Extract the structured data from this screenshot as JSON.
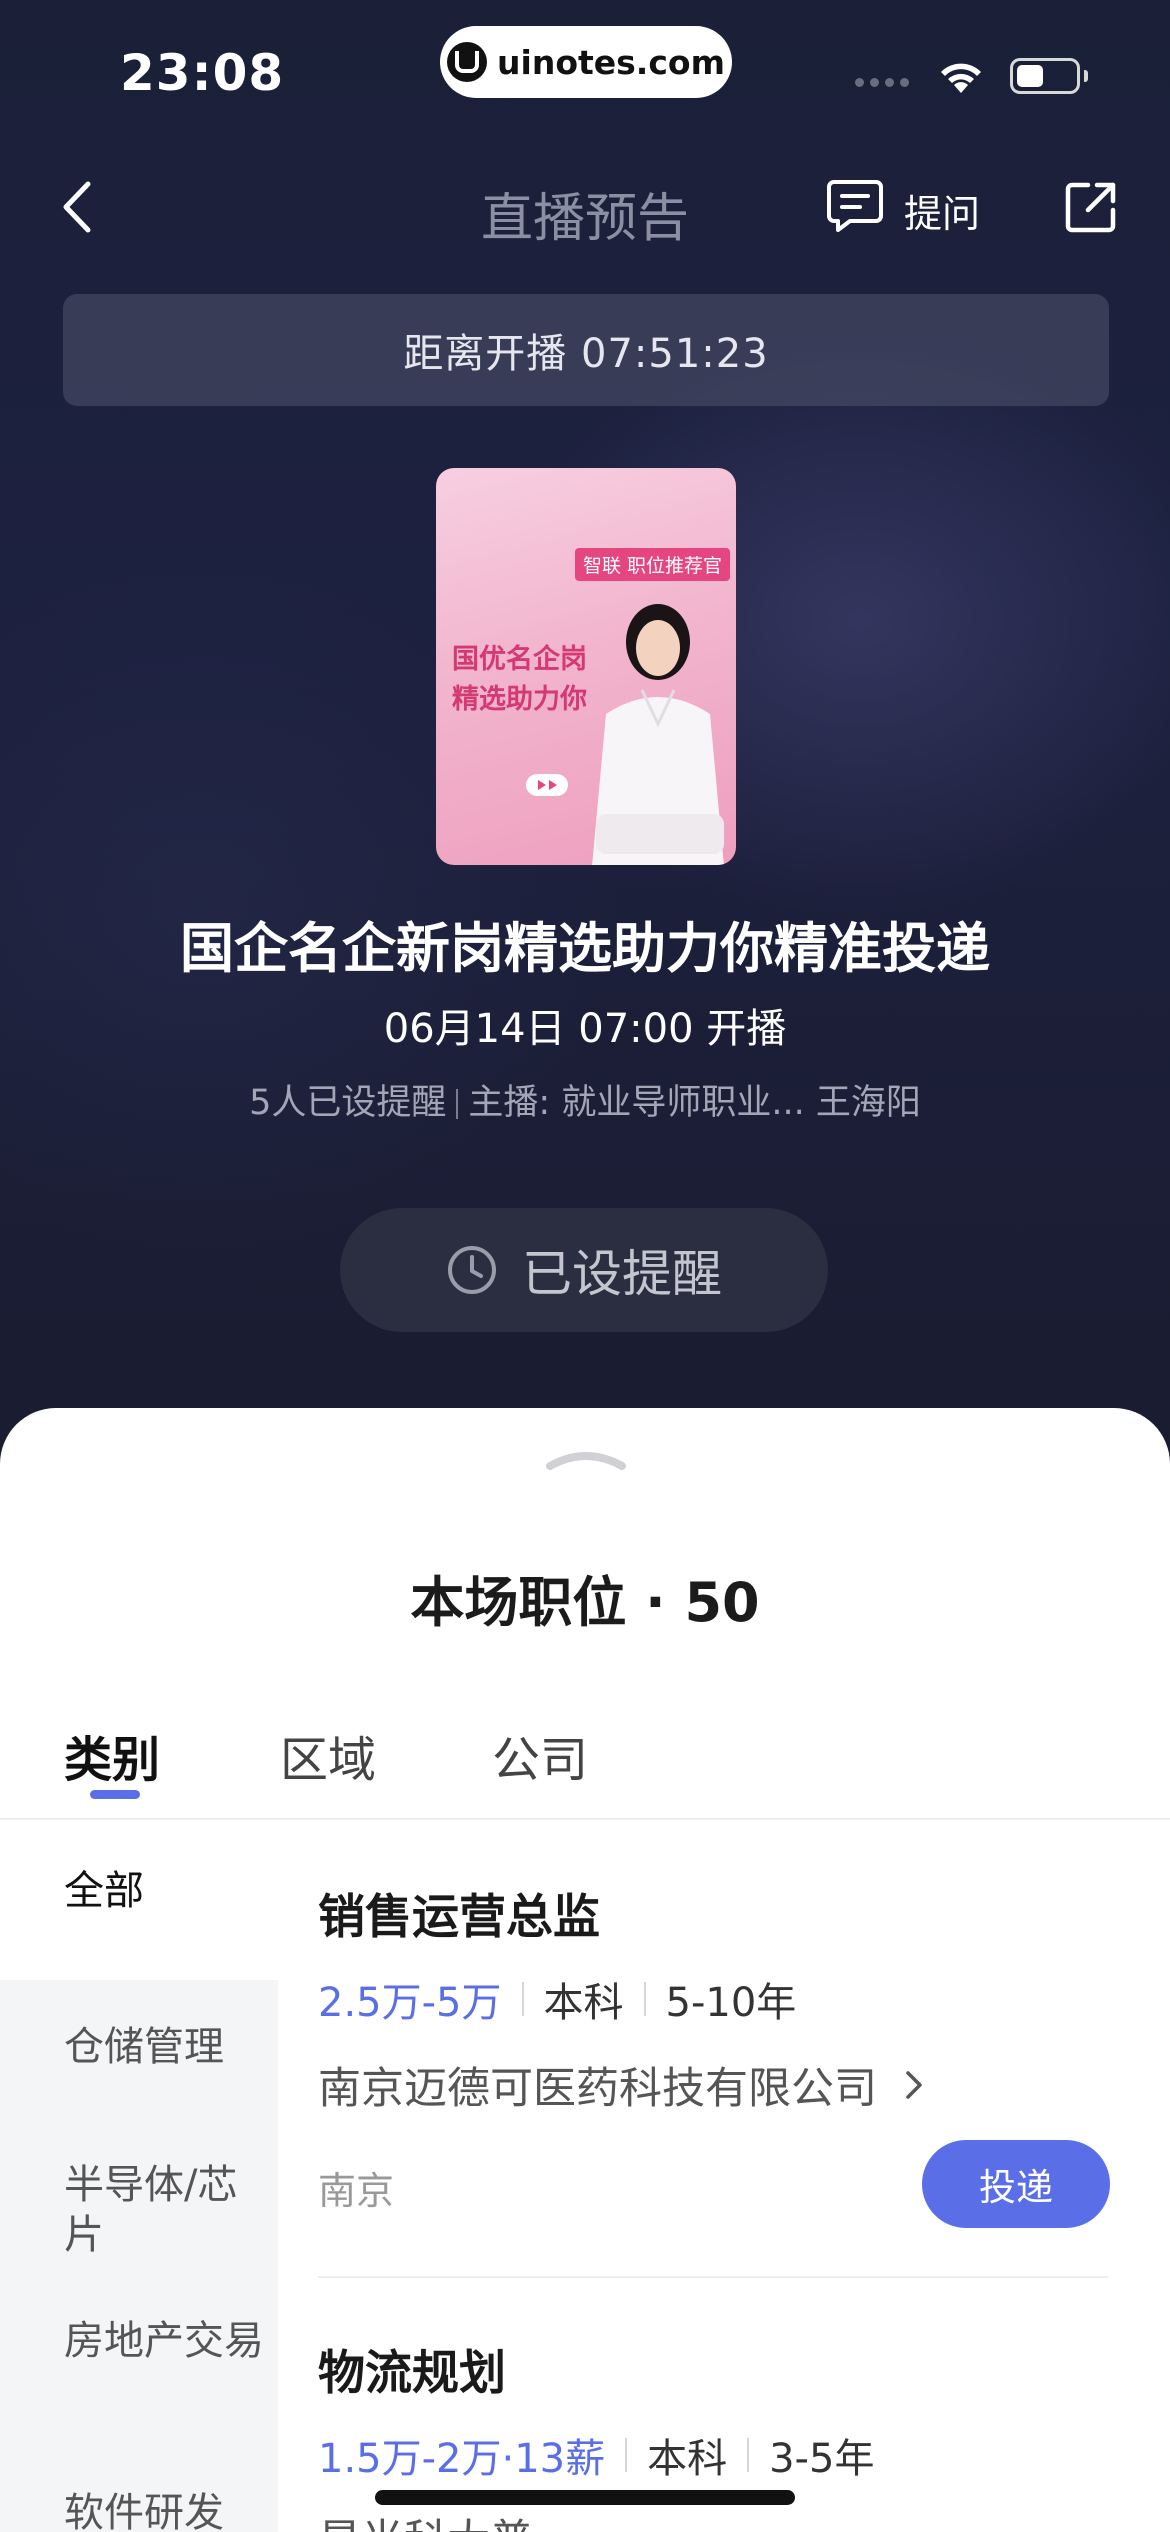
{
  "status_bar": {
    "time": "23:08",
    "url": "uinotes.com"
  },
  "nav": {
    "title": "直播预告",
    "ask_label": "提问"
  },
  "countdown": {
    "text": "距离开播 07:51:23"
  },
  "poster": {
    "badge": "智联 职位推荐官",
    "slogan": "国优名企岗 精选助力你"
  },
  "event": {
    "title": "国企名企新岗精选助力你精准投递",
    "start_time": "06月14日 07:00 开播",
    "reminder_count": "5人已设提醒",
    "host": "主播: 就业导师职业... 王海阳"
  },
  "reminder_button": {
    "label": "已设提醒"
  },
  "sheet": {
    "title": "本场职位 · 50",
    "tabs": [
      {
        "label": "类别"
      },
      {
        "label": "区域"
      },
      {
        "label": "公司"
      }
    ],
    "categories": [
      "全部",
      "仓储管理",
      "半导体/芯片",
      "房地产交易",
      "软件研发"
    ],
    "jobs": [
      {
        "title": "销售运营总监",
        "salary": "2.5万-5万",
        "education": "本科",
        "experience": "5-10年",
        "company": "南京迈德可医药科技有限公司",
        "city": "南京",
        "apply_label": "投递"
      },
      {
        "title": "物流规划",
        "salary": "1.5万-2万·13薪",
        "education": "本科",
        "experience": "3-5年",
        "company": "星光科大普"
      }
    ]
  },
  "colors": {
    "accent": "#5a6ee8",
    "dark_bg": "#1b2038",
    "poster_pink": "#ee9fbe"
  }
}
